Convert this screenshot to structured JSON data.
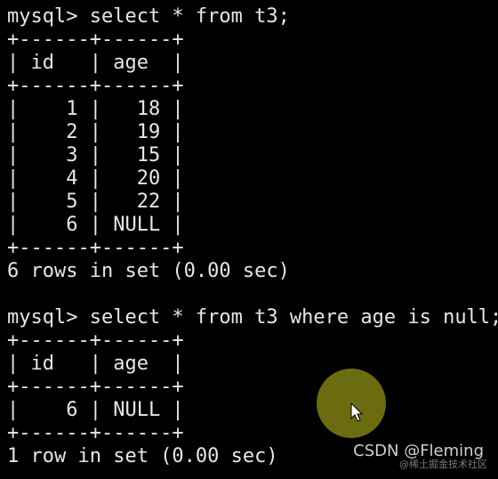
{
  "terminal": {
    "lines": [
      "mysql> select * from t3;",
      "+------+------+",
      "| id   | age  |",
      "+------+------+",
      "|    1 |   18 |",
      "|    2 |   19 |",
      "|    3 |   15 |",
      "|    4 |   20 |",
      "|    5 |   22 |",
      "|    6 | NULL |",
      "+------+------+",
      "6 rows in set (0.00 sec)",
      "",
      "mysql> select * from t3 where age is null;",
      "+------+------+",
      "| id   | age  |",
      "+------+------+",
      "|    6 | NULL |",
      "+------+------+",
      "1 row in set (0.00 sec)"
    ]
  },
  "watermark": {
    "text": "CSDN @Fleming",
    "subtext": "@稀土掘金技术社区"
  },
  "colors": {
    "background": "#000000",
    "text": "#e6e6e6",
    "cursor_highlight": "#6b6b10"
  }
}
